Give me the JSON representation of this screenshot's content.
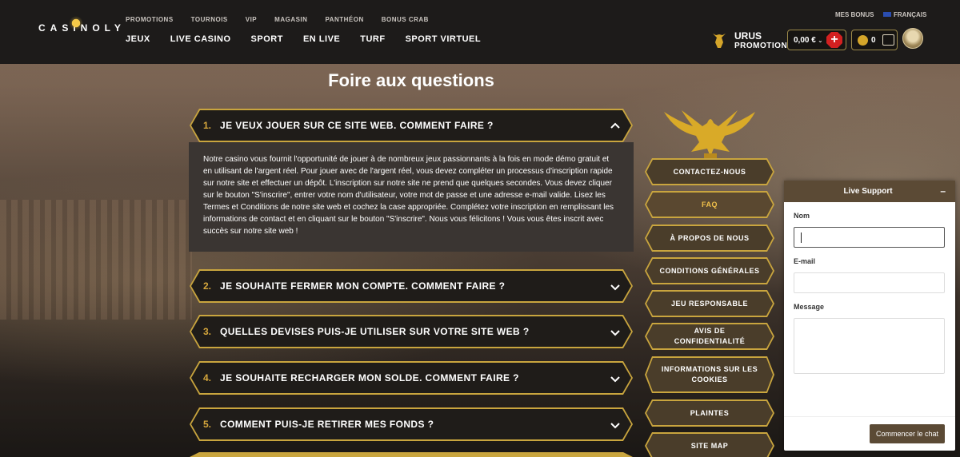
{
  "brand": {
    "logo_text": "CASINOLY"
  },
  "header": {
    "top_nav": [
      "PROMOTIONS",
      "TOURNOIS",
      "VIP",
      "MAGASIN",
      "PANTHÉON",
      "BONUS CRAB"
    ],
    "main_nav": [
      "JEUX",
      "LIVE CASINO",
      "SPORT",
      "EN LIVE",
      "TURF",
      "SPORT VIRTUEL"
    ],
    "mes_bonus": "MES BONUS",
    "language": "FRANÇAIS",
    "promo_title": "URUS",
    "promo_sub": "PROMOTION",
    "balance": "0,00 €",
    "coins": "0"
  },
  "page": {
    "title": "Foire aux questions"
  },
  "faq": {
    "items": [
      {
        "num": "1.",
        "question": "JE VEUX JOUER SUR CE SITE WEB. COMMENT FAIRE ?"
      },
      {
        "num": "2.",
        "question": "JE SOUHAITE FERMER MON COMPTE. COMMENT FAIRE ?"
      },
      {
        "num": "3.",
        "question": "QUELLES DEVISES PUIS-JE UTILISER SUR VOTRE SITE WEB ?"
      },
      {
        "num": "4.",
        "question": "JE SOUHAITE RECHARGER MON SOLDE. COMMENT FAIRE ?"
      },
      {
        "num": "5.",
        "question": "COMMENT PUIS-JE RETIRER MES FONDS ?"
      }
    ],
    "answer_1": "Notre casino vous fournit l'opportunité de jouer à de nombreux jeux passionnants à la fois en mode démo gratuit et en utilisant de l'argent réel. Pour jouer avec de l'argent réel, vous devez compléter un processus d'inscription rapide sur notre site et effectuer un dépôt. L'inscription sur notre site ne prend que quelques secondes. Vous devez cliquer sur le bouton \"S'inscrire\", entrer votre nom d'utilisateur, votre mot de passe et une adresse e-mail valide. Lisez les Termes et Conditions de notre site web et cochez la case appropriée. Complétez votre inscription en remplissant les informations de contact et en cliquant sur le bouton \"S'inscrire\". Nous vous félicitons ! Vous vous êtes inscrit avec succès sur notre site web !"
  },
  "side_menu": {
    "items": [
      "CONTACTEZ-NOUS",
      "FAQ",
      "À PROPOS DE NOUS",
      "CONDITIONS GÉNÉRALES",
      "JEU RESPONSABLE",
      "AVIS DE CONFIDENTIALITÉ",
      "INFORMATIONS SUR LES COOKIES",
      "PLAINTES",
      "SITE MAP"
    ],
    "active": "FAQ"
  },
  "support": {
    "title": "Live Support",
    "minimize": "–",
    "name_label": "Nom",
    "email_label": "E-mail",
    "message_label": "Message",
    "start_button": "Commencer le chat"
  },
  "colors": {
    "accent_gold": "#c9a53e",
    "header_bg": "#1d1b1a",
    "support_brown": "#5b4a35"
  }
}
